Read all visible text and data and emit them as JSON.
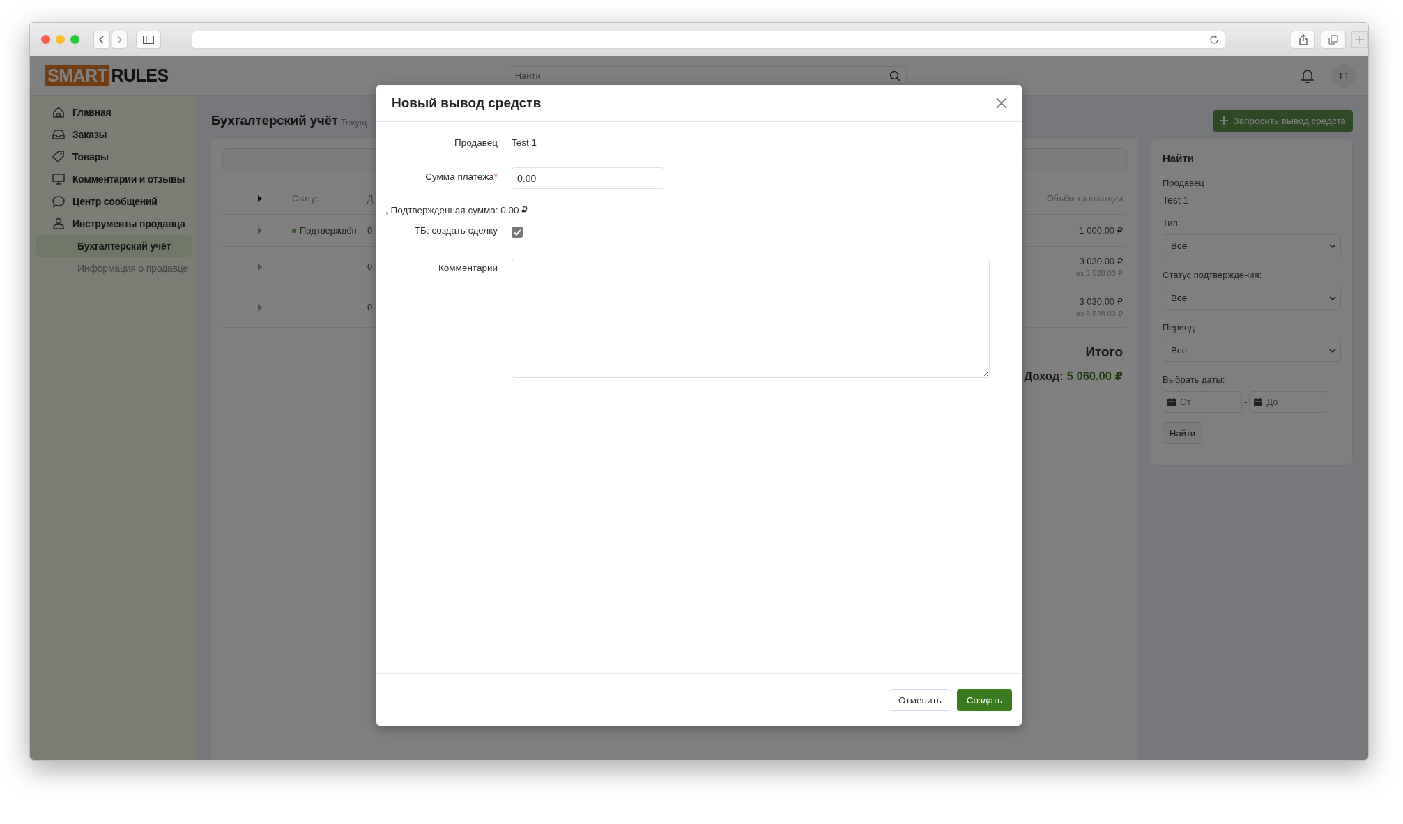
{
  "header": {
    "logo": {
      "left": "SMART",
      "right": "RULES"
    },
    "search": {
      "placeholder": "Найти"
    },
    "avatar": "TT"
  },
  "sidebar": {
    "items": [
      {
        "label": "Главная",
        "selected": false
      },
      {
        "label": "Заказы",
        "selected": false
      },
      {
        "label": "Товары",
        "selected": false
      },
      {
        "label": "Комментарии и отзывы",
        "selected": false
      },
      {
        "label": "Центр сообщений",
        "selected": false
      },
      {
        "label": "Инструменты продавца",
        "selected": false,
        "children": [
          {
            "label": "Бухгалтерский учёт",
            "selected": true
          },
          {
            "label": "Информация о продавце",
            "selected": false
          }
        ]
      }
    ]
  },
  "page": {
    "title": "Бухгалтерский учёт",
    "subtitle": "Текущ",
    "request_button": "Запросить вывод средств"
  },
  "table": {
    "columns": {
      "status": "Статус",
      "column_3": "Д",
      "amount": "Объём транзакции"
    },
    "rows": [
      {
        "status": "Подтверждён",
        "column_3": "0",
        "amount": "-1 000.00 ₽"
      },
      {
        "column_3": "0",
        "amount": "3 030.00 ₽",
        "amount_note": "из 3 528.00 ₽"
      },
      {
        "column_3": "0",
        "amount": "3 030.00 ₽",
        "amount_note": "из 3 528.00 ₽"
      }
    ]
  },
  "totals": {
    "title": "Итого",
    "income_label": "Доход:",
    "income_value": "5 060.00 ₽"
  },
  "filter": {
    "title": "Найти",
    "seller_label": "Продавец",
    "seller_value": "Test 1",
    "selects": [
      {
        "label": "Тип:",
        "value": "Все"
      },
      {
        "label": "Статус подтверждения:",
        "value": "Все"
      },
      {
        "label": "Период:",
        "value": "Все"
      }
    ],
    "dates_label": "Выбрать даты:",
    "date_from": {
      "placeholder": "От"
    },
    "date_separator": "-",
    "date_to": {
      "placeholder": "До"
    },
    "button": "Найти"
  },
  "modal": {
    "title": "Новый вывод средств",
    "seller_label": "Продавец",
    "seller_value": "Test 1",
    "amount_label": "Сумма платежа",
    "required_mark": "*",
    "amount_value": "0.00",
    "confirmed_text": ", Подтвержденная сумма: 0.00 ₽",
    "deal_label": "ТБ: создать сделку",
    "deal_checked": true,
    "comments_label": "Комментарии",
    "cancel_button": "Отменить",
    "create_button": "Создать"
  }
}
